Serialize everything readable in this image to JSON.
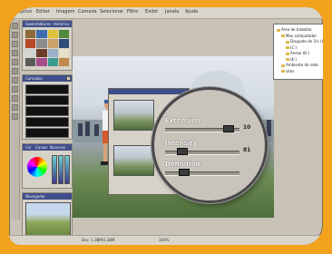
{
  "menubar": {
    "items": [
      "Arquivo",
      "Editar",
      "Imagem",
      "Camada",
      "Selecionar",
      "Filtro",
      "Exibir",
      "Janela",
      "Ajuda"
    ]
  },
  "panels": {
    "swatches": {
      "tabs": [
        "Swatches",
        "Cores",
        "Histórico"
      ],
      "colors": [
        "#8c6b3a",
        "#3b6fb0",
        "#e0c23a",
        "#4f8a3c",
        "#b74a2b",
        "#8c8c8c",
        "#c9a26a",
        "#2f4d7a",
        "#d3d3d3",
        "#6b3e2a",
        "#9ab0c9",
        "#e8e1c7",
        "#5a5a5a",
        "#a54d8b",
        "#3a9a8f",
        "#c08a4a"
      ]
    },
    "layers": {
      "title": "Camadas"
    },
    "color": {
      "tabs": [
        "Cor",
        "Canais",
        "Nuances"
      ]
    },
    "navigator": {
      "title": "Navegador"
    }
  },
  "magnifier": {
    "sliders": [
      {
        "label": "Extension",
        "value": "10",
        "fraction": 0.92
      },
      {
        "label": "Intensity",
        "value": "81",
        "fraction": 0.18
      },
      {
        "label": "Definition",
        "value": "",
        "fraction": 0.22
      }
    ]
  },
  "explorer": {
    "items": [
      {
        "label": "Área de trabalho",
        "level": 0
      },
      {
        "label": "Meu computador",
        "level": 1
      },
      {
        "label": "Disquete de 3½ (A:)",
        "level": 2
      },
      {
        "label": "(C:)",
        "level": 2
      },
      {
        "label": "Anexo (D:)",
        "level": 2
      },
      {
        "label": "(E:)",
        "level": 2
      },
      {
        "label": "Ambiente de rede",
        "level": 1
      },
      {
        "label": "sites",
        "level": 1
      }
    ]
  },
  "statusbar": {
    "left": "Doc: 1,38M/1,38M",
    "right": "100%"
  }
}
